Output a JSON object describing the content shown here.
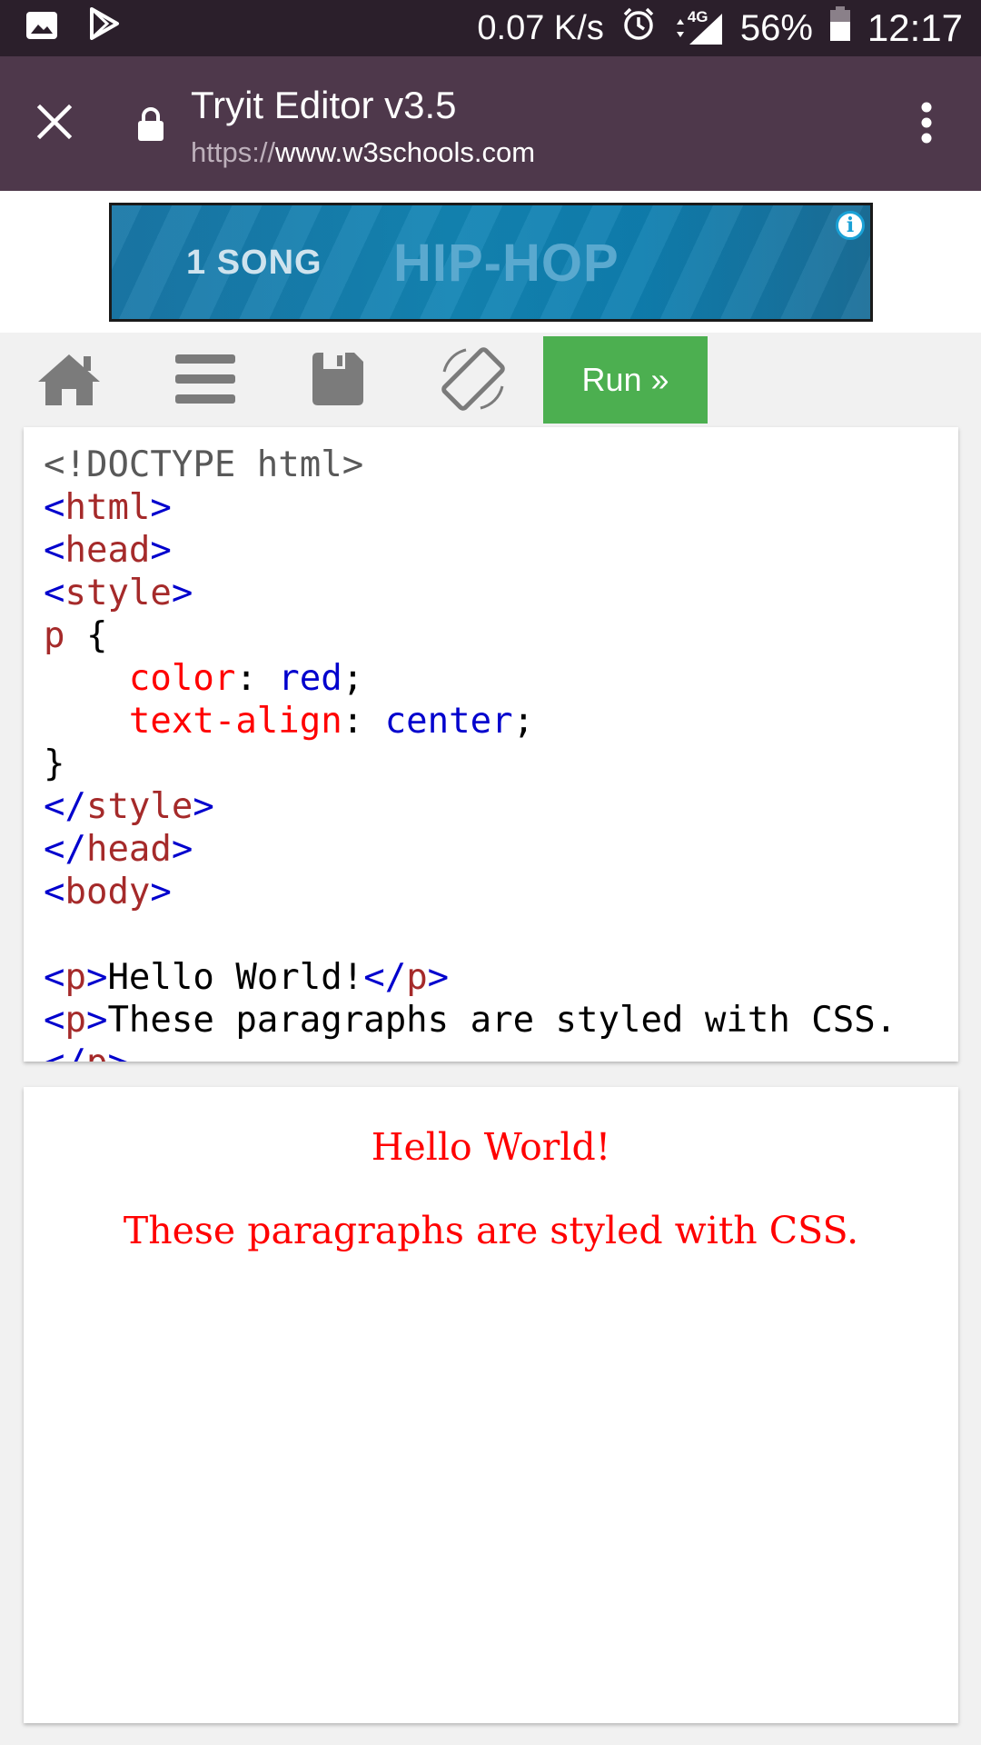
{
  "status_bar": {
    "speed": "0.07 K/s",
    "network": "4G",
    "battery": "56%",
    "time": "12:17",
    "icons": [
      "image-icon",
      "play-store-icon",
      "alarm-icon",
      "data-arrows-icon",
      "signal-icon",
      "battery-icon"
    ]
  },
  "browser": {
    "title": "Tryit Editor v3.5",
    "url_scheme": "https://",
    "url_host": "www.w3schools.com",
    "icons": [
      "close-icon",
      "lock-icon",
      "more-vert-icon"
    ]
  },
  "ad": {
    "text1": "1 SONG",
    "text2": "HIP-HOP",
    "info_glyph": "i"
  },
  "toolbar": {
    "icons": [
      "home-icon",
      "menu-icon",
      "save-icon",
      "rotate-icon"
    ],
    "run_label": "Run »"
  },
  "editor": {
    "lines": [
      [
        {
          "t": "<!DOCTYPE html>",
          "c": "gray"
        }
      ],
      [
        {
          "t": "<",
          "c": "blue"
        },
        {
          "t": "html",
          "c": "brown"
        },
        {
          "t": ">",
          "c": "blue"
        }
      ],
      [
        {
          "t": "<",
          "c": "blue"
        },
        {
          "t": "head",
          "c": "brown"
        },
        {
          "t": ">",
          "c": "blue"
        }
      ],
      [
        {
          "t": "<",
          "c": "blue"
        },
        {
          "t": "style",
          "c": "brown"
        },
        {
          "t": ">",
          "c": "blue"
        }
      ],
      [
        {
          "t": "p",
          "c": "brown"
        },
        {
          "t": " {",
          "c": "black"
        }
      ],
      [
        {
          "t": "    ",
          "c": "black"
        },
        {
          "t": "color",
          "c": "red"
        },
        {
          "t": ": ",
          "c": "black"
        },
        {
          "t": "red",
          "c": "blue"
        },
        {
          "t": ";",
          "c": "black"
        }
      ],
      [
        {
          "t": "    ",
          "c": "black"
        },
        {
          "t": "text-align",
          "c": "red"
        },
        {
          "t": ": ",
          "c": "black"
        },
        {
          "t": "center",
          "c": "blue"
        },
        {
          "t": ";",
          "c": "black"
        }
      ],
      [
        {
          "t": "}",
          "c": "black"
        }
      ],
      [
        {
          "t": "</",
          "c": "blue"
        },
        {
          "t": "style",
          "c": "brown"
        },
        {
          "t": ">",
          "c": "blue"
        }
      ],
      [
        {
          "t": "</",
          "c": "blue"
        },
        {
          "t": "head",
          "c": "brown"
        },
        {
          "t": ">",
          "c": "blue"
        }
      ],
      [
        {
          "t": "<",
          "c": "blue"
        },
        {
          "t": "body",
          "c": "brown"
        },
        {
          "t": ">",
          "c": "blue"
        }
      ],
      [
        {
          "t": "",
          "c": "black"
        }
      ],
      [
        {
          "t": "<",
          "c": "blue"
        },
        {
          "t": "p",
          "c": "brown"
        },
        {
          "t": ">",
          "c": "blue"
        },
        {
          "t": "Hello World!",
          "c": "black"
        },
        {
          "t": "</",
          "c": "blue"
        },
        {
          "t": "p",
          "c": "brown"
        },
        {
          "t": ">",
          "c": "blue"
        }
      ],
      [
        {
          "t": "<",
          "c": "blue"
        },
        {
          "t": "p",
          "c": "brown"
        },
        {
          "t": ">",
          "c": "blue"
        },
        {
          "t": "These paragraphs are styled with CSS.",
          "c": "black"
        }
      ],
      [
        {
          "t": "</",
          "c": "blue"
        },
        {
          "t": "p",
          "c": "brown"
        },
        {
          "t": ">",
          "c": "blue"
        }
      ]
    ]
  },
  "result": {
    "p1": "Hello World!",
    "p2": "These paragraphs are styled with CSS."
  },
  "colors": {
    "status_bar": "#2b1f2b",
    "app_bar": "#4e384b",
    "run_button": "#4caf50",
    "result_text": "#ff0000",
    "code_tag": "#0000cd",
    "code_name": "#a52a2a",
    "code_property": "#ff0000"
  }
}
